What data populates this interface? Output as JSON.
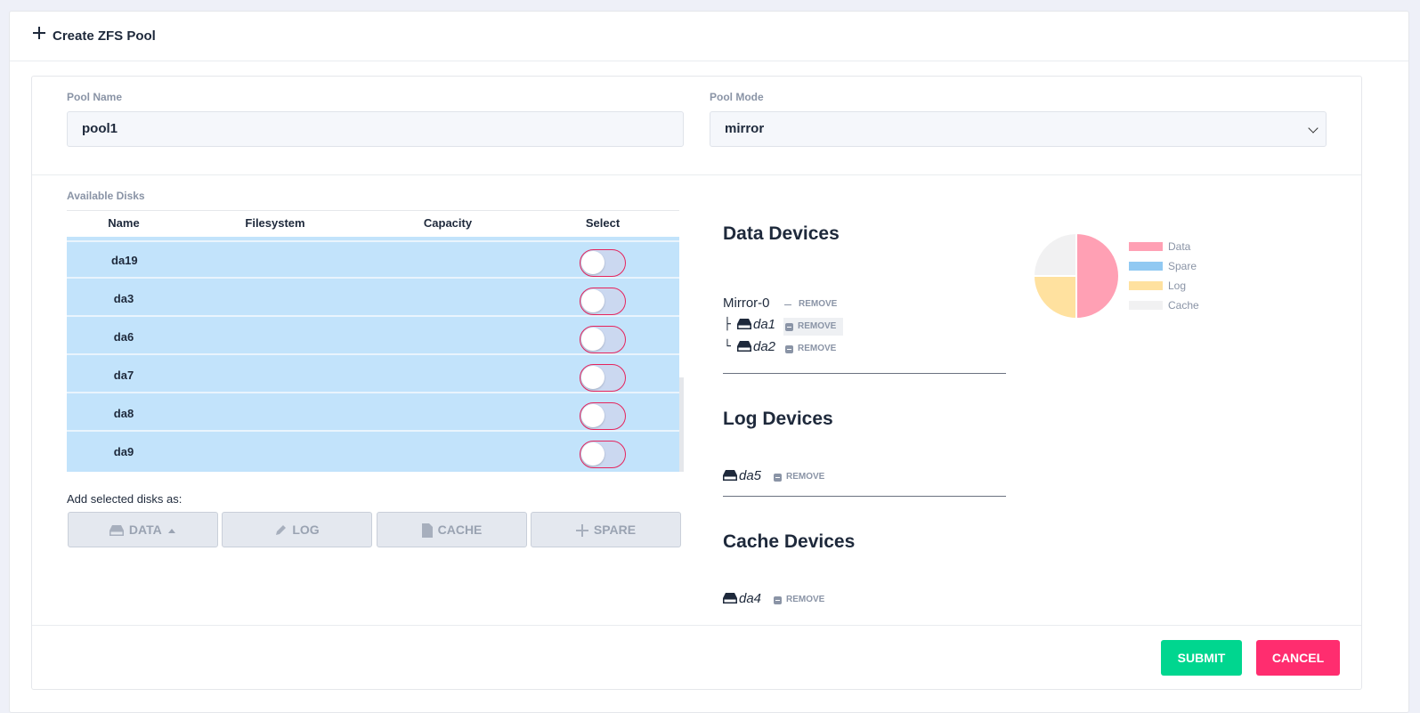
{
  "header": {
    "title": "Create ZFS Pool"
  },
  "pool_name": {
    "label": "Pool Name",
    "value": "pool1"
  },
  "pool_mode": {
    "label": "Pool Mode",
    "value": "mirror"
  },
  "available_disks": {
    "label": "Available Disks",
    "columns": [
      "Name",
      "Filesystem",
      "Capacity",
      "Select"
    ],
    "rows": [
      {
        "name": "da19"
      },
      {
        "name": "da3"
      },
      {
        "name": "da6"
      },
      {
        "name": "da7"
      },
      {
        "name": "da8"
      },
      {
        "name": "da9"
      }
    ]
  },
  "add_selected_label": "Add selected disks as:",
  "add_buttons": {
    "data": "DATA",
    "log": "LOG",
    "cache": "CACHE",
    "spare": "SPARE"
  },
  "data_devices": {
    "title": "Data Devices",
    "mirror": {
      "name": "Mirror-0",
      "remove": "REMOVE"
    },
    "disks": [
      {
        "name": "da1",
        "remove": "REMOVE"
      },
      {
        "name": "da2",
        "remove": "REMOVE"
      }
    ]
  },
  "log_devices": {
    "title": "Log Devices",
    "disks": [
      {
        "name": "da5",
        "remove": "REMOVE"
      }
    ]
  },
  "cache_devices": {
    "title": "Cache Devices",
    "disks": [
      {
        "name": "da4",
        "remove": "REMOVE"
      }
    ]
  },
  "chart_data": {
    "type": "pie",
    "labels": [
      "Data",
      "Spare",
      "Log",
      "Cache"
    ],
    "values": [
      2,
      0,
      1,
      1
    ],
    "colors": [
      "#ffa0b4",
      "#91c9f2",
      "#ffe19f",
      "#f1f1f2"
    ],
    "legend_position": "right"
  },
  "actions": {
    "submit": "SUBMIT",
    "cancel": "CANCEL"
  },
  "colors": {
    "submit": "#00d68f",
    "cancel": "#ff2d6f",
    "selected_row": "#c2e3fb"
  }
}
